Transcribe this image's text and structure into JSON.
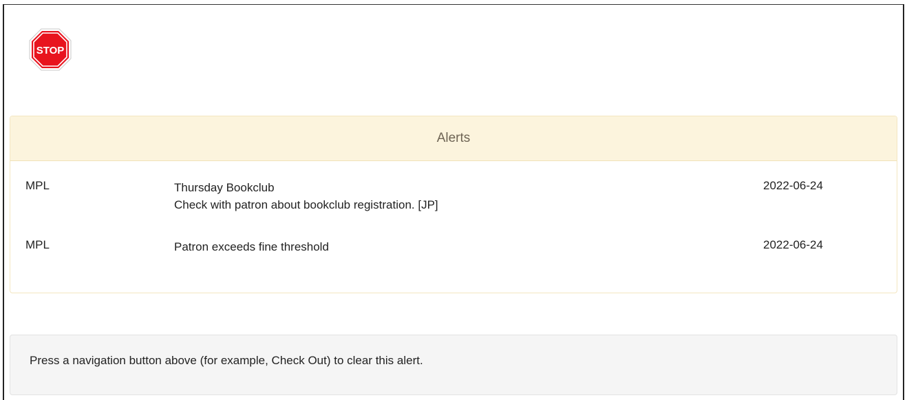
{
  "stop_icon": {
    "text": "STOP",
    "color": "#e8141e"
  },
  "alerts_panel": {
    "title": "Alerts",
    "rows": [
      {
        "library": "MPL",
        "title": "Thursday Bookclub",
        "note": "Check with patron about bookclub registration. [JP]",
        "date": "2022-06-24"
      },
      {
        "library": "MPL",
        "title": "Patron exceeds fine threshold",
        "note": "",
        "date": "2022-06-24"
      }
    ]
  },
  "info_well": {
    "text": "Press a navigation button above (for example, Check Out) to clear this alert."
  }
}
